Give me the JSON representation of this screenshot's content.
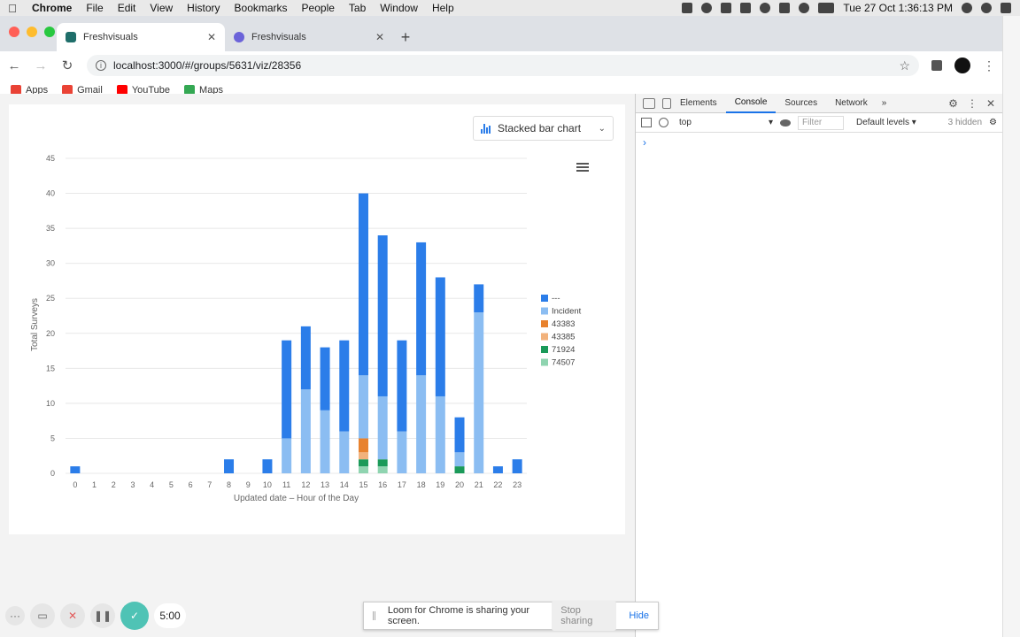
{
  "menubar": {
    "app": "Chrome",
    "items": [
      "File",
      "Edit",
      "View",
      "History",
      "Bookmarks",
      "People",
      "Tab",
      "Window",
      "Help"
    ],
    "clock": "Tue 27 Oct  1:36:13 PM"
  },
  "tabs": [
    {
      "title": "Freshvisuals",
      "color": "#1f6e6a"
    },
    {
      "title": "Freshvisuals",
      "color": "#6b63d9"
    }
  ],
  "omnibox": {
    "url": "localhost:3000/#/groups/5631/viz/28356"
  },
  "bookmarks": [
    {
      "label": "Apps",
      "color": "#e94235"
    },
    {
      "label": "Gmail",
      "color": "#ea4335"
    },
    {
      "label": "YouTube",
      "color": "#ff0000"
    },
    {
      "label": "Maps",
      "color": "#34a853"
    }
  ],
  "chart_selector": {
    "label": "Stacked bar chart"
  },
  "chart_data": {
    "type": "bar",
    "stacked": true,
    "categories": [
      "0",
      "1",
      "2",
      "3",
      "4",
      "5",
      "6",
      "7",
      "8",
      "9",
      "10",
      "11",
      "12",
      "13",
      "14",
      "15",
      "16",
      "17",
      "18",
      "19",
      "20",
      "21",
      "22",
      "23"
    ],
    "series": [
      {
        "name": "74507",
        "color": "#8fd4b0",
        "values": [
          0,
          0,
          0,
          0,
          0,
          0,
          0,
          0,
          0,
          0,
          0,
          0,
          0,
          0,
          0,
          1,
          1,
          0,
          0,
          0,
          0,
          0,
          0,
          0
        ]
      },
      {
        "name": "71924",
        "color": "#1b9a59",
        "values": [
          0,
          0,
          0,
          0,
          0,
          0,
          0,
          0,
          0,
          0,
          0,
          0,
          0,
          0,
          0,
          1,
          1,
          0,
          0,
          0,
          1,
          0,
          0,
          0
        ]
      },
      {
        "name": "43385",
        "color": "#f2b27c",
        "values": [
          0,
          0,
          0,
          0,
          0,
          0,
          0,
          0,
          0,
          0,
          0,
          0,
          0,
          0,
          0,
          1,
          0,
          0,
          0,
          0,
          0,
          0,
          0,
          0
        ]
      },
      {
        "name": "43383",
        "color": "#e8822e",
        "values": [
          0,
          0,
          0,
          0,
          0,
          0,
          0,
          0,
          0,
          0,
          0,
          0,
          0,
          0,
          0,
          2,
          0,
          0,
          0,
          0,
          0,
          0,
          0,
          0
        ]
      },
      {
        "name": "Incident",
        "color": "#8bbdf2",
        "values": [
          0,
          0,
          0,
          0,
          0,
          0,
          0,
          0,
          0,
          0,
          0,
          5,
          12,
          9,
          6,
          9,
          9,
          6,
          14,
          11,
          2,
          23,
          0,
          0
        ]
      },
      {
        "name": "---",
        "color": "#2b7de9",
        "values": [
          1,
          0,
          0,
          0,
          0,
          0,
          0,
          0,
          2,
          0,
          2,
          14,
          9,
          9,
          13,
          26,
          23,
          13,
          19,
          17,
          5,
          4,
          1,
          2
        ]
      }
    ],
    "legend_order": [
      "---",
      "Incident",
      "43383",
      "43385",
      "71924",
      "74507"
    ],
    "xlabel": "Updated date – Hour of the Day",
    "ylabel": "Total Surveys",
    "ylim": [
      0,
      45
    ],
    "yticks": [
      0,
      5,
      10,
      15,
      20,
      25,
      30,
      35,
      40,
      45
    ],
    "grid": true,
    "legend_position": "right"
  },
  "devtools": {
    "tabs": [
      "Elements",
      "Console",
      "Sources",
      "Network"
    ],
    "active_tab": "Console",
    "context": "top",
    "filter_placeholder": "Filter",
    "levels": "Default levels ▾",
    "hidden": "3 hidden",
    "prompt": "›"
  },
  "loom": {
    "timer": "5:00",
    "message": "Loom for Chrome is sharing your screen.",
    "stop": "Stop sharing",
    "hide": "Hide"
  }
}
